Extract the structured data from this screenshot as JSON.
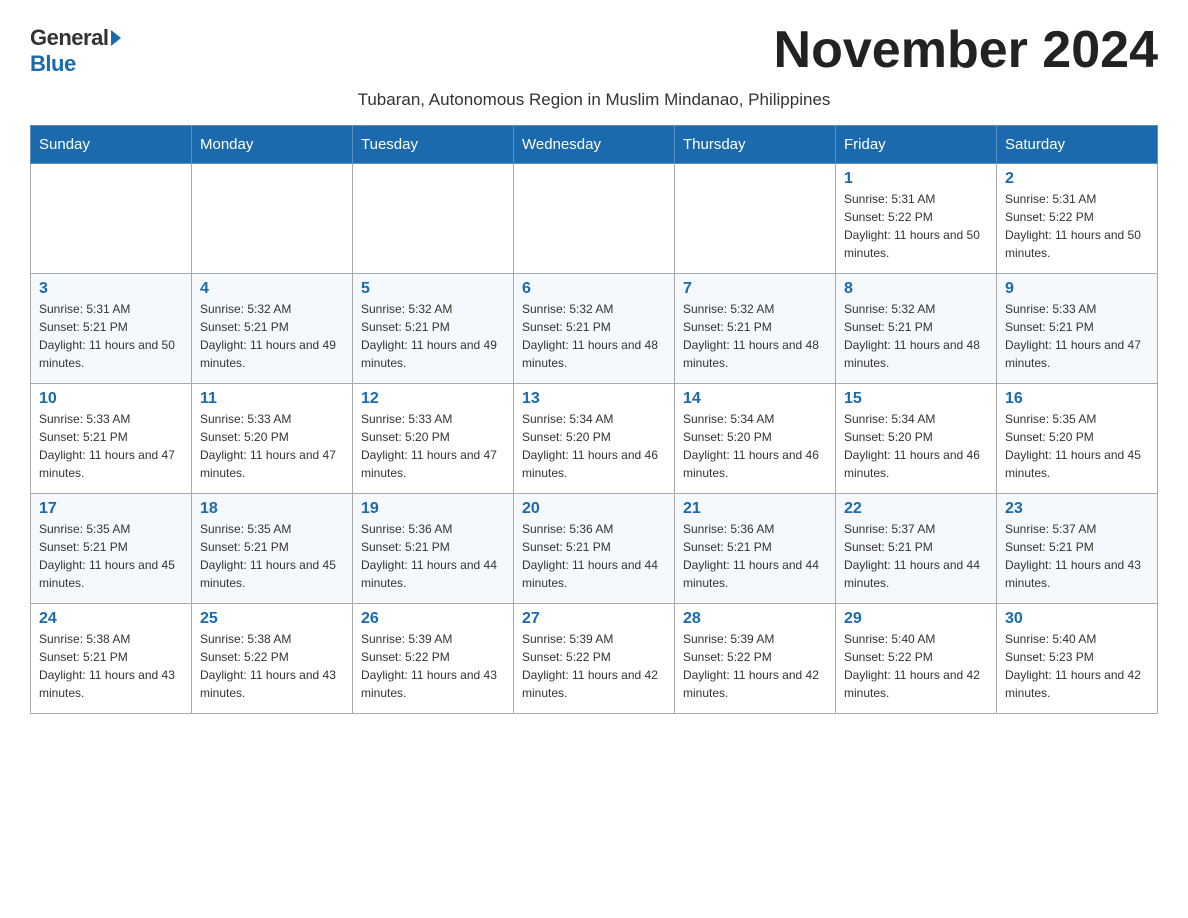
{
  "header": {
    "logo_general": "General",
    "logo_blue": "Blue",
    "month_title": "November 2024",
    "subtitle": "Tubaran, Autonomous Region in Muslim Mindanao, Philippines"
  },
  "weekdays": [
    "Sunday",
    "Monday",
    "Tuesday",
    "Wednesday",
    "Thursday",
    "Friday",
    "Saturday"
  ],
  "weeks": [
    [
      {
        "day": "",
        "info": ""
      },
      {
        "day": "",
        "info": ""
      },
      {
        "day": "",
        "info": ""
      },
      {
        "day": "",
        "info": ""
      },
      {
        "day": "",
        "info": ""
      },
      {
        "day": "1",
        "info": "Sunrise: 5:31 AM\nSunset: 5:22 PM\nDaylight: 11 hours and 50 minutes."
      },
      {
        "day": "2",
        "info": "Sunrise: 5:31 AM\nSunset: 5:22 PM\nDaylight: 11 hours and 50 minutes."
      }
    ],
    [
      {
        "day": "3",
        "info": "Sunrise: 5:31 AM\nSunset: 5:21 PM\nDaylight: 11 hours and 50 minutes."
      },
      {
        "day": "4",
        "info": "Sunrise: 5:32 AM\nSunset: 5:21 PM\nDaylight: 11 hours and 49 minutes."
      },
      {
        "day": "5",
        "info": "Sunrise: 5:32 AM\nSunset: 5:21 PM\nDaylight: 11 hours and 49 minutes."
      },
      {
        "day": "6",
        "info": "Sunrise: 5:32 AM\nSunset: 5:21 PM\nDaylight: 11 hours and 48 minutes."
      },
      {
        "day": "7",
        "info": "Sunrise: 5:32 AM\nSunset: 5:21 PM\nDaylight: 11 hours and 48 minutes."
      },
      {
        "day": "8",
        "info": "Sunrise: 5:32 AM\nSunset: 5:21 PM\nDaylight: 11 hours and 48 minutes."
      },
      {
        "day": "9",
        "info": "Sunrise: 5:33 AM\nSunset: 5:21 PM\nDaylight: 11 hours and 47 minutes."
      }
    ],
    [
      {
        "day": "10",
        "info": "Sunrise: 5:33 AM\nSunset: 5:21 PM\nDaylight: 11 hours and 47 minutes."
      },
      {
        "day": "11",
        "info": "Sunrise: 5:33 AM\nSunset: 5:20 PM\nDaylight: 11 hours and 47 minutes."
      },
      {
        "day": "12",
        "info": "Sunrise: 5:33 AM\nSunset: 5:20 PM\nDaylight: 11 hours and 47 minutes."
      },
      {
        "day": "13",
        "info": "Sunrise: 5:34 AM\nSunset: 5:20 PM\nDaylight: 11 hours and 46 minutes."
      },
      {
        "day": "14",
        "info": "Sunrise: 5:34 AM\nSunset: 5:20 PM\nDaylight: 11 hours and 46 minutes."
      },
      {
        "day": "15",
        "info": "Sunrise: 5:34 AM\nSunset: 5:20 PM\nDaylight: 11 hours and 46 minutes."
      },
      {
        "day": "16",
        "info": "Sunrise: 5:35 AM\nSunset: 5:20 PM\nDaylight: 11 hours and 45 minutes."
      }
    ],
    [
      {
        "day": "17",
        "info": "Sunrise: 5:35 AM\nSunset: 5:21 PM\nDaylight: 11 hours and 45 minutes."
      },
      {
        "day": "18",
        "info": "Sunrise: 5:35 AM\nSunset: 5:21 PM\nDaylight: 11 hours and 45 minutes."
      },
      {
        "day": "19",
        "info": "Sunrise: 5:36 AM\nSunset: 5:21 PM\nDaylight: 11 hours and 44 minutes."
      },
      {
        "day": "20",
        "info": "Sunrise: 5:36 AM\nSunset: 5:21 PM\nDaylight: 11 hours and 44 minutes."
      },
      {
        "day": "21",
        "info": "Sunrise: 5:36 AM\nSunset: 5:21 PM\nDaylight: 11 hours and 44 minutes."
      },
      {
        "day": "22",
        "info": "Sunrise: 5:37 AM\nSunset: 5:21 PM\nDaylight: 11 hours and 44 minutes."
      },
      {
        "day": "23",
        "info": "Sunrise: 5:37 AM\nSunset: 5:21 PM\nDaylight: 11 hours and 43 minutes."
      }
    ],
    [
      {
        "day": "24",
        "info": "Sunrise: 5:38 AM\nSunset: 5:21 PM\nDaylight: 11 hours and 43 minutes."
      },
      {
        "day": "25",
        "info": "Sunrise: 5:38 AM\nSunset: 5:22 PM\nDaylight: 11 hours and 43 minutes."
      },
      {
        "day": "26",
        "info": "Sunrise: 5:39 AM\nSunset: 5:22 PM\nDaylight: 11 hours and 43 minutes."
      },
      {
        "day": "27",
        "info": "Sunrise: 5:39 AM\nSunset: 5:22 PM\nDaylight: 11 hours and 42 minutes."
      },
      {
        "day": "28",
        "info": "Sunrise: 5:39 AM\nSunset: 5:22 PM\nDaylight: 11 hours and 42 minutes."
      },
      {
        "day": "29",
        "info": "Sunrise: 5:40 AM\nSunset: 5:22 PM\nDaylight: 11 hours and 42 minutes."
      },
      {
        "day": "30",
        "info": "Sunrise: 5:40 AM\nSunset: 5:23 PM\nDaylight: 11 hours and 42 minutes."
      }
    ]
  ],
  "colors": {
    "header_bg": "#1a6aad",
    "header_text": "#ffffff",
    "day_number": "#1a6aad",
    "border": "#aaaaaa"
  }
}
